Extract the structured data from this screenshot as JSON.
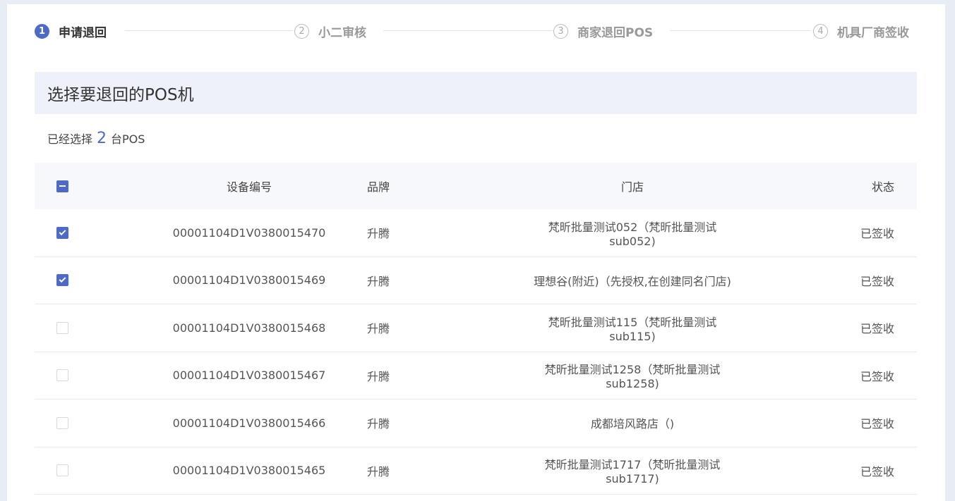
{
  "steps": [
    {
      "num": "1",
      "label": "申请退回",
      "active": true
    },
    {
      "num": "②",
      "label": "小二审核",
      "active": false
    },
    {
      "num": "③",
      "label": "商家退回POS",
      "active": false
    },
    {
      "num": "④",
      "label": "机具厂商签收",
      "active": false
    }
  ],
  "section": {
    "title": "选择要退回的POS机"
  },
  "summary": {
    "prefix": "已经选择",
    "count": "2",
    "suffix": "台POS"
  },
  "table": {
    "headers": {
      "id": "设备编号",
      "brand": "品牌",
      "store": "门店",
      "status": "状态"
    },
    "select_all_state": "partial",
    "rows": [
      {
        "checked": true,
        "id": "00001104D1V0380015470",
        "brand": "升腾",
        "store": "梵昕批量测试052（梵昕批量测试sub052)",
        "status": "已签收"
      },
      {
        "checked": true,
        "id": "00001104D1V0380015469",
        "brand": "升腾",
        "store": "理想谷(附近)（先授权,在创建同名门店)",
        "status": "已签收"
      },
      {
        "checked": false,
        "id": "00001104D1V0380015468",
        "brand": "升腾",
        "store": "梵昕批量测试115（梵昕批量测试sub115)",
        "status": "已签收"
      },
      {
        "checked": false,
        "id": "00001104D1V0380015467",
        "brand": "升腾",
        "store": "梵昕批量测试1258（梵昕批量测试sub1258)",
        "status": "已签收"
      },
      {
        "checked": false,
        "id": "00001104D1V0380015466",
        "brand": "升腾",
        "store": "成都培风路店（)",
        "status": "已签收"
      },
      {
        "checked": false,
        "id": "00001104D1V0380015465",
        "brand": "升腾",
        "store": "梵昕批量测试1717（梵昕批量测试sub1717)",
        "status": "已签收"
      }
    ]
  },
  "colors": {
    "accent": "#4d6bc6",
    "header_bg": "#eef1f9",
    "page_bg": "#e8ecf5"
  }
}
